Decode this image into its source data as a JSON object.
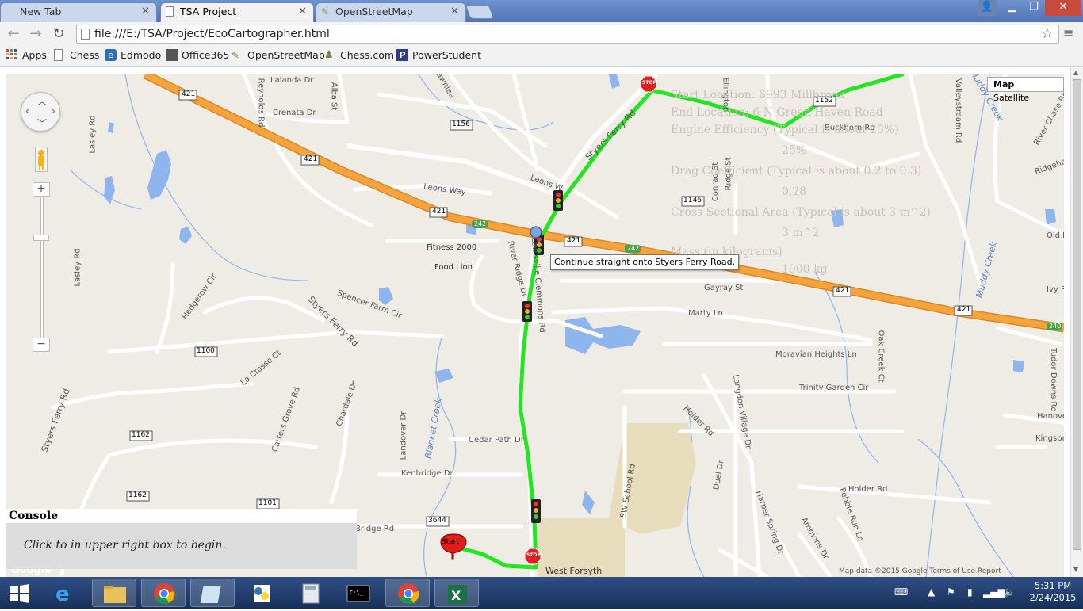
{
  "tabs": [
    {
      "label": "New Tab",
      "active": false
    },
    {
      "label": "TSA Project",
      "active": true
    },
    {
      "label": "OpenStreetMap",
      "active": false
    }
  ],
  "toolbar": {
    "url": "file:///E:/TSA/Project/EcoCartographer.html"
  },
  "bookmarks": [
    {
      "label": "Apps",
      "icon": "apps-grid-icon"
    },
    {
      "label": "Chess",
      "icon": "page-icon"
    },
    {
      "label": "Edmodo",
      "icon": "edmodo-icon"
    },
    {
      "label": "Office365",
      "icon": "office365-icon"
    },
    {
      "label": "OpenStreetMap",
      "icon": "openstreetmap-icon"
    },
    {
      "label": "Chess.com",
      "icon": "pawn-icon"
    },
    {
      "label": "PowerStudent",
      "icon": "powerstudent-icon"
    }
  ],
  "map": {
    "type_controls": {
      "map": "Map",
      "satellite": "Satellite"
    },
    "tooltip": "Continue straight onto Styers Ferry Road.",
    "start_marker": "Start",
    "stop_sign": "STOP",
    "labels": {
      "lalanda": "Lalanda Dr",
      "crenata": "Crenata Dr",
      "alba": "Alba St",
      "reynolds": "Reynolds Rd",
      "dawnlee": "Dawnlee",
      "leons_way": "Leons Way",
      "leons_w": "Leons W",
      "fitness": "Fitness 2000",
      "food_lion": "Food Lion",
      "river_ridge": "River Ridge Dr",
      "spencer_farm": "Spencer Farm Cir",
      "styers_ferry_rd_1": "Styers Ferry Rd",
      "styers_ferry_rd_2": "Styers Ferry Rd",
      "styers_ferry_rd_3": "Styers Ferry Rd",
      "hedgerow": "Hedgerow Cir",
      "la_crosse": "La Crosse Ct",
      "carters_grove": "Carters Grove Rd",
      "chardale": "Chardale Dr",
      "landover": "Landover Dr",
      "blanket_creek": "Blanket Creek",
      "cedar_path": "Cedar Path Dr",
      "kenbridge": "Kenbridge Dr",
      "lewisville": "Lewisville Clemmons Rd",
      "sw_school": "SW School Rd",
      "west_forsyth": "West Forsyth",
      "gayray": "Gayray St",
      "marty": "Marty Ln",
      "moravian": "Moravian Heights Ln",
      "trinity": "Trinity Garden Cir",
      "oak_creek": "Oak Creek Ct",
      "holder": "Holder Rd",
      "holder_2": "Holder Rd",
      "langdon": "Langdon Village Dr",
      "duel": "Duel Dr",
      "harper_spring": "Harper Spring Dr",
      "ammons": "Ammons Dr",
      "pebble_run": "Pebble Run Ln",
      "muddy_creek_1": "Muddy Creek",
      "muddy_creek_2": "Muddy Creek",
      "river_chase": "River Chase Rd",
      "ridgehaven": "Ridgehaven",
      "old_f": "Old F",
      "ivy_ri": "Ivy Ri",
      "tudor_downs": "Tudor Downs Rd",
      "hanove": "Hanove",
      "kingsbrid": "Kingsbrid",
      "buckhorn": "Buckhorn Rd",
      "valleystream": "Valleystream Rd",
      "ellington": "Ellington",
      "conrad": "Conrad St",
      "ridge": "Ridge St",
      "lasley": "Lasley Rd",
      "lasley_2": "Lasley Rd",
      "styers_ferry_left": "Styers Ferry Rd",
      "bridge": "Bridge Rd",
      "google": "Google",
      "map_data": "Map data ©2015 Google  Terms of Use  Report"
    },
    "shields": {
      "s421a": "421",
      "s421b": "421",
      "s421c": "421",
      "s421d": "421",
      "s421e": "421",
      "s421f": "421",
      "s1156": "1156",
      "s1146": "1146",
      "s1100": "1100",
      "s1162a": "1162",
      "s1162b": "1162",
      "s1101": "1101",
      "s3644": "3644",
      "s1152": "1152",
      "s242a": "242",
      "s242b": "242",
      "s240": "240"
    }
  },
  "info_panel": {
    "start_location": "Start Location: 6993 Millbrook",
    "end_location": "End Location: 6 N Green Haven Road",
    "engine_eff_label": "Engine Efficiency (Typical is about 25%)",
    "engine_eff_value": "25%",
    "drag_label": "Drag Coefficient (Typical is about 0.2 to 0.3)",
    "drag_value": "0.28",
    "area_label": "Cross Sectional Area (Typical is about 3 m^2)",
    "area_value": "3 m^2",
    "mass_label": "Mass (in kilograms)",
    "mass_value": "1000 kg"
  },
  "console": {
    "title": "Console",
    "message": "Click to in upper right box to begin."
  },
  "taskbar": {
    "time": "5:31 PM",
    "date": "2/24/2015"
  },
  "colors": {
    "route": "#22e61f",
    "highway": "#f5a33a",
    "water": "#8fb5ee",
    "map_bg": "#efece6"
  }
}
